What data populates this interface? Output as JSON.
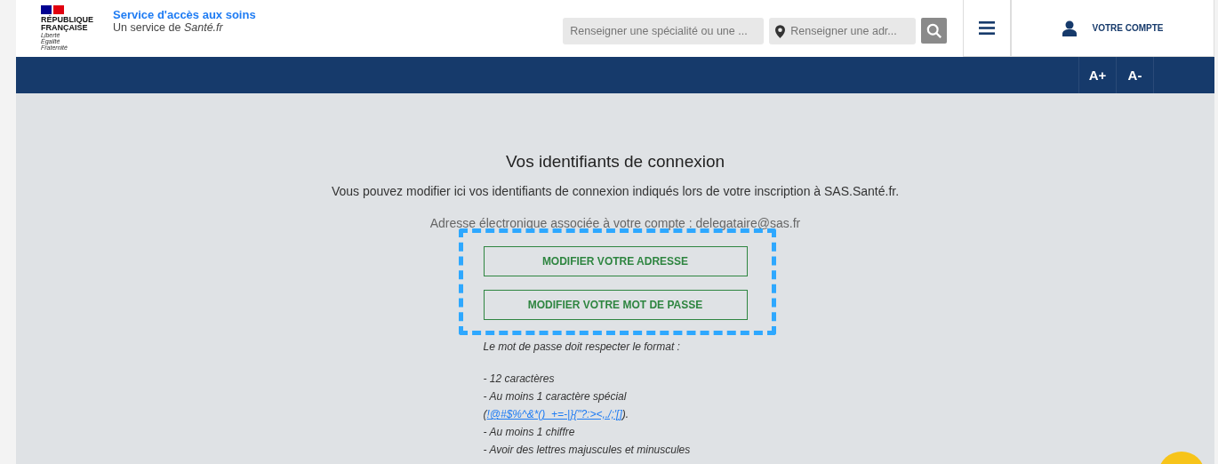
{
  "header": {
    "logo_lines": [
      "RÉPUBLIQUE",
      "FRANÇAISE"
    ],
    "motto": [
      "Liberté",
      "Égalité",
      "Fraternité"
    ],
    "site_title": "Service d'accès aux soins",
    "site_subtitle": "Un service de *Santé.fr*",
    "search": {
      "placeholder": "Renseigner une spécialité ou une ..."
    },
    "address": {
      "placeholder": "Renseigner une adr..."
    },
    "account": "VOTRE COMPTE"
  },
  "toolbar": {
    "buttons": [
      "A+",
      "A-"
    ]
  },
  "main": {
    "title": "Vos identifiants de connexion",
    "intro": "Vous pouvez modifier ici vos identifiants de connexion indiqués lors de votre inscription à SAS.Santé.fr.",
    "email_line": "Adresse électronique associée à votre compte : delegataire@sas.fr",
    "buttons": [
      "MODIFIER VOTRE ADRESSE",
      "MODIFIER VOTRE MOT DE PASSE"
    ],
    "rules_title": "Le mot de passe doit respecter le format :",
    "rules": [
      {
        "kind": "text",
        "text": "- 12 caractères"
      },
      {
        "kind": "link",
        "text": "- Au moins 1 caractère spécial (",
        "link": "!@#$%^&*()_+=-|}{\"?:><,./;'[]",
        "after": ")."
      },
      {
        "kind": "text",
        "text": "- Au moins 1 chiffre"
      },
      {
        "kind": "text",
        "text": "- Avoir des lettres majuscules et minuscules"
      }
    ]
  }
}
